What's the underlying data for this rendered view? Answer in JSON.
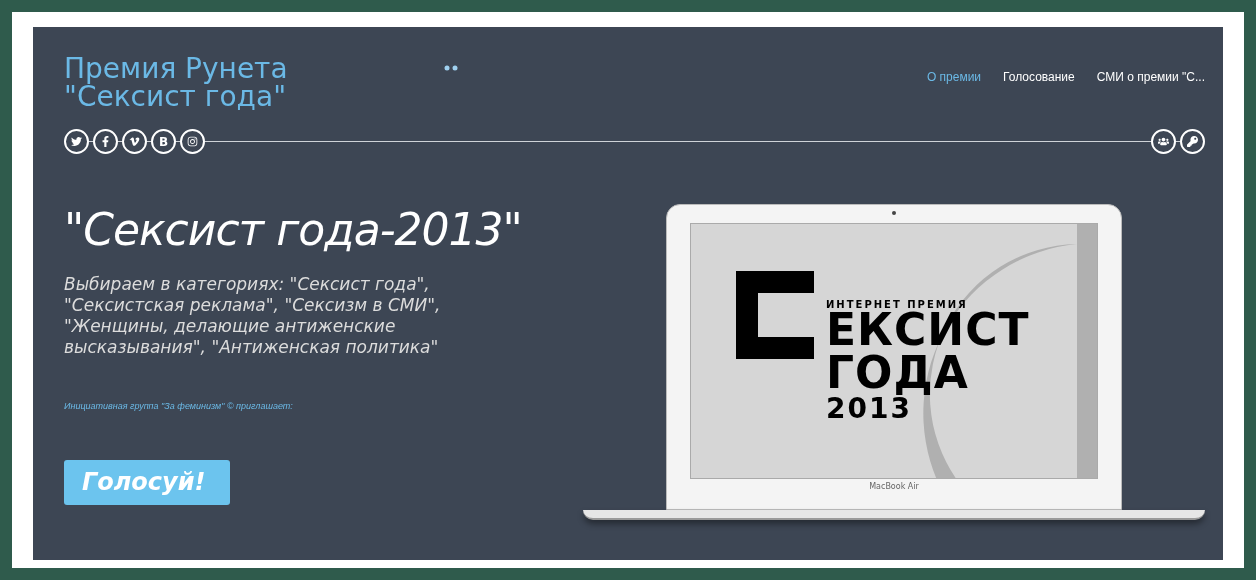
{
  "site_title": {
    "line1": "Премия Рунета",
    "line2": "\"Сексист года\""
  },
  "nav": [
    {
      "label": "О премии",
      "selected": true
    },
    {
      "label": "Голосование",
      "selected": false
    },
    {
      "label": "СМИ о премии \"С...",
      "selected": false
    }
  ],
  "social": [
    {
      "kind": "twitter"
    },
    {
      "kind": "facebook"
    },
    {
      "kind": "vimeo"
    },
    {
      "kind": "letter",
      "text": "B"
    },
    {
      "kind": "camera"
    }
  ],
  "account": [
    {
      "kind": "users"
    },
    {
      "kind": "key"
    }
  ],
  "hero": {
    "title": "\"Сексист года-2013\"",
    "subtitle": "Выбираем в категориях: \"Сексист года\", \"Сексистская реклама\", \"Сексизм в СМИ\", \"Женщины, делающие антиженские высказывания\", \"Антиженская политика\"",
    "invite": "Инициативная группа \"За феминизм\" © приглашает:",
    "button": "Голосуй!"
  },
  "laptop": {
    "kicker": "ИНТЕРНЕТ ПРЕМИЯ",
    "word": "ЕКСИСТ",
    "line2": "ГОДА",
    "year": "2013",
    "brand": "MacBook Air"
  }
}
